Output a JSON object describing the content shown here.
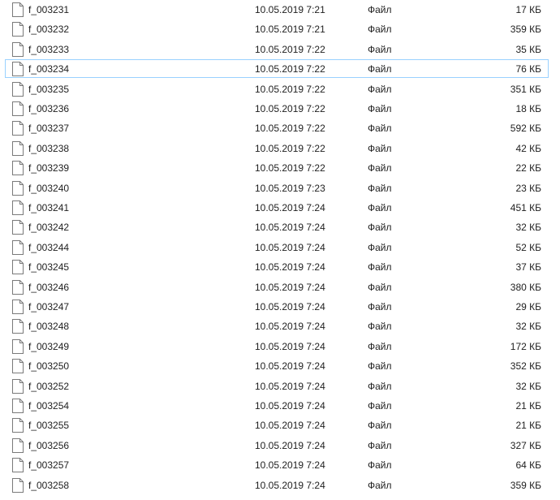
{
  "icon": "file-icon",
  "focused_color": "#99d1ff",
  "focused_index": 3,
  "files": [
    {
      "name": "f_003231",
      "date": "10.05.2019 7:21",
      "type": "Файл",
      "size": "17 КБ"
    },
    {
      "name": "f_003232",
      "date": "10.05.2019 7:21",
      "type": "Файл",
      "size": "359 КБ"
    },
    {
      "name": "f_003233",
      "date": "10.05.2019 7:22",
      "type": "Файл",
      "size": "35 КБ"
    },
    {
      "name": "f_003234",
      "date": "10.05.2019 7:22",
      "type": "Файл",
      "size": "76 КБ"
    },
    {
      "name": "f_003235",
      "date": "10.05.2019 7:22",
      "type": "Файл",
      "size": "351 КБ"
    },
    {
      "name": "f_003236",
      "date": "10.05.2019 7:22",
      "type": "Файл",
      "size": "18 КБ"
    },
    {
      "name": "f_003237",
      "date": "10.05.2019 7:22",
      "type": "Файл",
      "size": "592 КБ"
    },
    {
      "name": "f_003238",
      "date": "10.05.2019 7:22",
      "type": "Файл",
      "size": "42 КБ"
    },
    {
      "name": "f_003239",
      "date": "10.05.2019 7:22",
      "type": "Файл",
      "size": "22 КБ"
    },
    {
      "name": "f_003240",
      "date": "10.05.2019 7:23",
      "type": "Файл",
      "size": "23 КБ"
    },
    {
      "name": "f_003241",
      "date": "10.05.2019 7:24",
      "type": "Файл",
      "size": "451 КБ"
    },
    {
      "name": "f_003242",
      "date": "10.05.2019 7:24",
      "type": "Файл",
      "size": "32 КБ"
    },
    {
      "name": "f_003244",
      "date": "10.05.2019 7:24",
      "type": "Файл",
      "size": "52 КБ"
    },
    {
      "name": "f_003245",
      "date": "10.05.2019 7:24",
      "type": "Файл",
      "size": "37 КБ"
    },
    {
      "name": "f_003246",
      "date": "10.05.2019 7:24",
      "type": "Файл",
      "size": "380 КБ"
    },
    {
      "name": "f_003247",
      "date": "10.05.2019 7:24",
      "type": "Файл",
      "size": "29 КБ"
    },
    {
      "name": "f_003248",
      "date": "10.05.2019 7:24",
      "type": "Файл",
      "size": "32 КБ"
    },
    {
      "name": "f_003249",
      "date": "10.05.2019 7:24",
      "type": "Файл",
      "size": "172 КБ"
    },
    {
      "name": "f_003250",
      "date": "10.05.2019 7:24",
      "type": "Файл",
      "size": "352 КБ"
    },
    {
      "name": "f_003252",
      "date": "10.05.2019 7:24",
      "type": "Файл",
      "size": "32 КБ"
    },
    {
      "name": "f_003254",
      "date": "10.05.2019 7:24",
      "type": "Файл",
      "size": "21 КБ"
    },
    {
      "name": "f_003255",
      "date": "10.05.2019 7:24",
      "type": "Файл",
      "size": "21 КБ"
    },
    {
      "name": "f_003256",
      "date": "10.05.2019 7:24",
      "type": "Файл",
      "size": "327 КБ"
    },
    {
      "name": "f_003257",
      "date": "10.05.2019 7:24",
      "type": "Файл",
      "size": "64 КБ"
    },
    {
      "name": "f_003258",
      "date": "10.05.2019 7:24",
      "type": "Файл",
      "size": "359 КБ"
    }
  ]
}
